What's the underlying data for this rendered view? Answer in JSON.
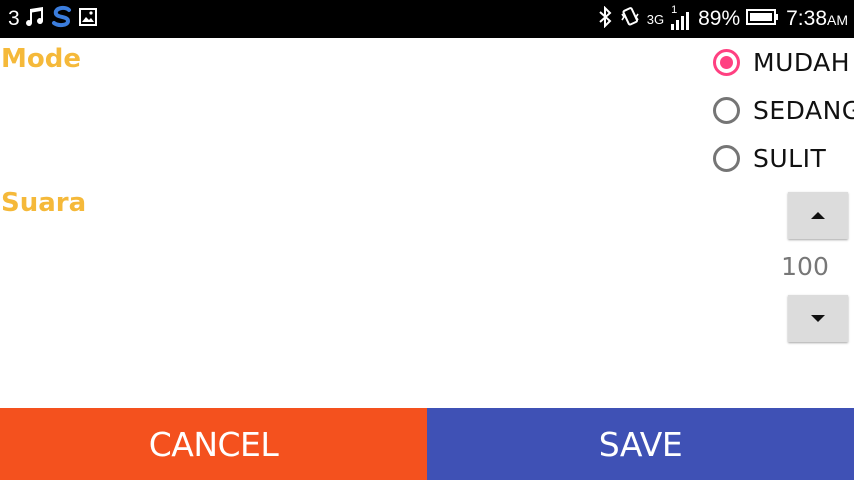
{
  "status_bar": {
    "notification_count": "3",
    "signal_small_digit": "1",
    "network_type": "3G",
    "battery_percent": "89%",
    "time": "7:38",
    "time_suffix": "AM",
    "icons": [
      "music-note-icon",
      "s-app-icon",
      "image-icon",
      "bluetooth-icon",
      "vibrate-icon",
      "signal-icon",
      "battery-icon"
    ]
  },
  "settings": {
    "mode_label": "Mode",
    "mode_options": [
      {
        "label": "MUDAH",
        "checked": true
      },
      {
        "label": "SEDANG",
        "checked": false
      },
      {
        "label": "SULIT",
        "checked": false
      }
    ],
    "sound_label": "Suara",
    "volume_value": "100"
  },
  "actions": {
    "cancel_label": "CANCEL",
    "save_label": "SAVE"
  },
  "colors": {
    "label_color": "#f5b93a",
    "radio_accent": "#ff4081",
    "cancel_bg": "#f4511e",
    "save_bg": "#3f51b5",
    "status_bar_bg": "#000000"
  }
}
